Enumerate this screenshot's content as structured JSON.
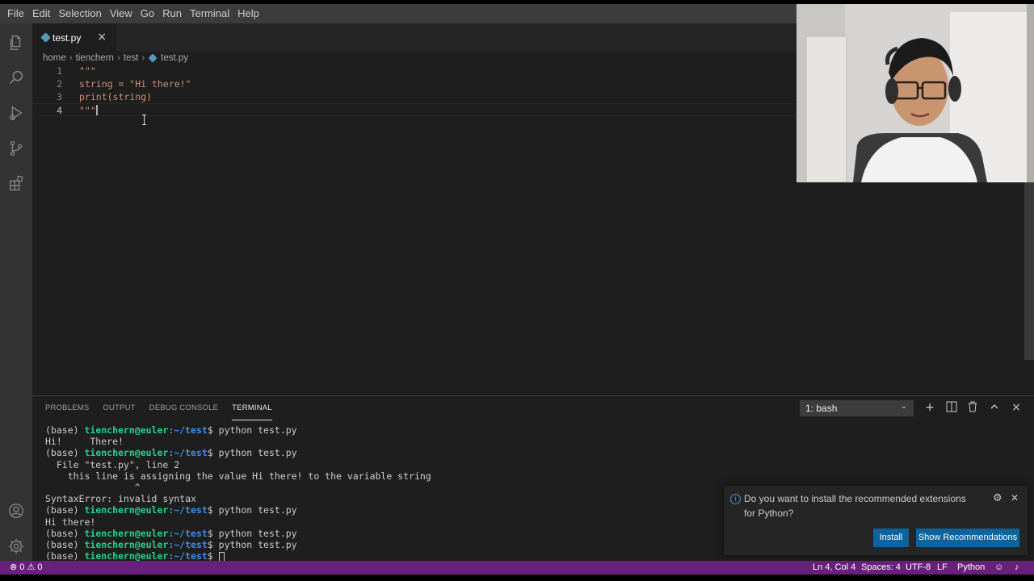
{
  "menu": [
    "File",
    "Edit",
    "Selection",
    "View",
    "Go",
    "Run",
    "Terminal",
    "Help"
  ],
  "activity_bar": {
    "top": [
      "files-icon",
      "search-icon",
      "run-debug-icon",
      "source-control-icon",
      "extensions-icon"
    ],
    "bottom": [
      "account-icon",
      "settings-gear-icon"
    ]
  },
  "tab": {
    "label": "test.py",
    "close": "×"
  },
  "breadcrumbs": [
    "home",
    "tienchern",
    "test",
    "test.py"
  ],
  "editor": {
    "lines": [
      {
        "no": "1",
        "text": "\"\"\""
      },
      {
        "no": "2",
        "text": "string = \"Hi there!\""
      },
      {
        "no": "3",
        "text": "print(string)"
      },
      {
        "no": "4",
        "text": "\"\"\""
      }
    ]
  },
  "panel": {
    "tabs": [
      "PROBLEMS",
      "OUTPUT",
      "DEBUG CONSOLE",
      "TERMINAL"
    ],
    "active_tab": "TERMINAL",
    "terminal_select": "1: bash"
  },
  "terminal": {
    "prompt_base": "(base) ",
    "user": "tienchern@euler",
    "path": ":~/test",
    "dollar": "$ ",
    "lines": [
      {
        "type": "prompt",
        "cmd": "python test.py"
      },
      {
        "type": "out",
        "text": "Hi!     There!"
      },
      {
        "type": "prompt",
        "cmd": "python test.py"
      },
      {
        "type": "out",
        "text": "  File \"test.py\", line 2"
      },
      {
        "type": "out",
        "text": "    this line is assigning the value Hi there! to the variable string"
      },
      {
        "type": "out",
        "text": "                ^"
      },
      {
        "type": "out",
        "text": "SyntaxError: invalid syntax"
      },
      {
        "type": "prompt",
        "cmd": "python test.py"
      },
      {
        "type": "out",
        "text": "Hi there!"
      },
      {
        "type": "prompt",
        "cmd": "python test.py"
      },
      {
        "type": "prompt",
        "cmd": "python test.py"
      },
      {
        "type": "prompt",
        "cmd": ""
      }
    ]
  },
  "notification": {
    "message": "Do you want to install the recommended extensions for Python?",
    "install": "Install",
    "show_recommendations": "Show Recommendations"
  },
  "statusbar": {
    "errors": "0",
    "warnings": "0",
    "position": "Ln 4, Col 4",
    "spaces": "Spaces: 4",
    "encoding": "UTF-8",
    "eol": "LF",
    "language": "Python"
  },
  "colors": {
    "statusbar_bg": "#68217a",
    "button_bg": "#0e639c",
    "terminal_user": "#23d18b",
    "terminal_path": "#3b8eea",
    "string": "#ce9178"
  }
}
